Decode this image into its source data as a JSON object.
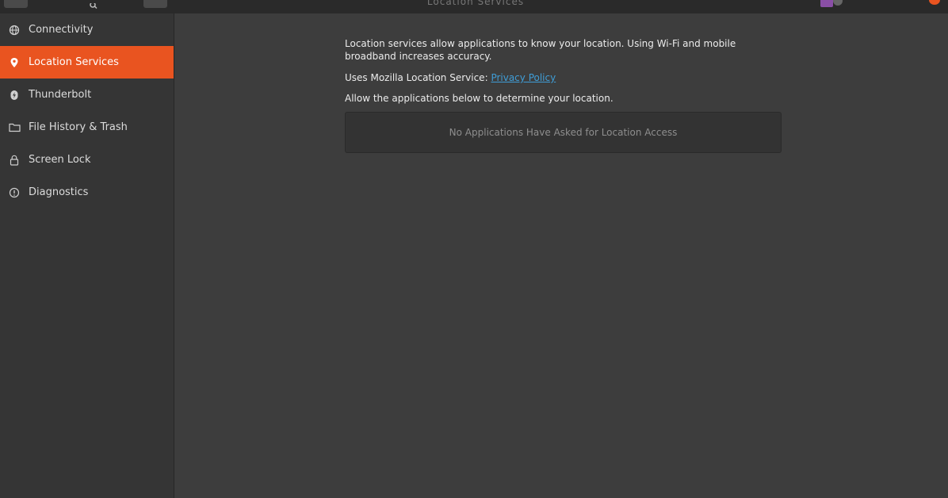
{
  "window": {
    "title": "Location Services",
    "search_icon": "search-icon",
    "close_color": "#e95420"
  },
  "sidebar": {
    "accent": "#e95420",
    "items": [
      {
        "label": "Connectivity",
        "icon": "globe-icon",
        "active": false
      },
      {
        "label": "Location Services",
        "icon": "location-pin-icon",
        "active": true
      },
      {
        "label": "Thunderbolt",
        "icon": "thunderbolt-icon",
        "active": false
      },
      {
        "label": "File History & Trash",
        "icon": "folder-icon",
        "active": false
      },
      {
        "label": "Screen Lock",
        "icon": "lock-icon",
        "active": false
      },
      {
        "label": "Diagnostics",
        "icon": "info-icon",
        "active": false
      }
    ]
  },
  "main": {
    "description": "Location services allow applications to know your location. Using Wi-Fi and mobile broadband increases accuracy.",
    "uses_prefix": "Uses Mozilla Location Service: ",
    "privacy_link": "Privacy Policy",
    "allow_text": "Allow the applications below to determine your location.",
    "empty_apps_message": "No Applications Have Asked for Location Access",
    "link_color": "#3f9dd6"
  }
}
